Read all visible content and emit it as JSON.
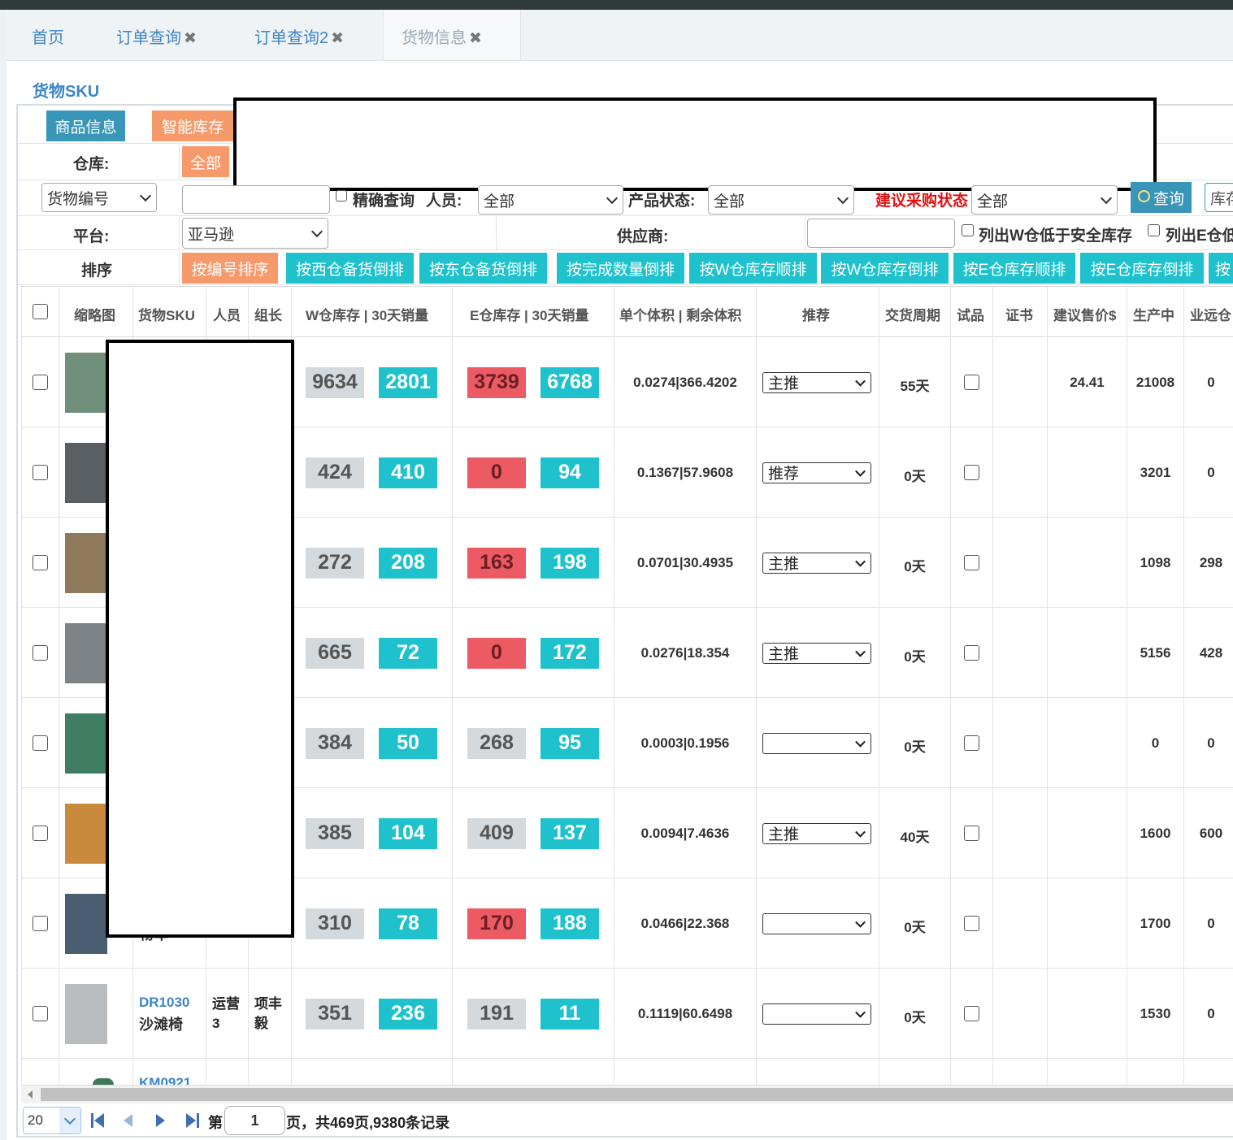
{
  "tabs": [
    {
      "label": "首页",
      "closable": false
    },
    {
      "label": "订单查询",
      "closable": true
    },
    {
      "label": "订单查询2",
      "closable": true
    },
    {
      "label": "货物信息",
      "closable": true
    }
  ],
  "close_glyph": "✖",
  "section_title": "货物SKU",
  "top_buttons": {
    "product_info": "商品信息",
    "smart_stock": "智能库存"
  },
  "warehouse": {
    "label": "仓库:",
    "all_button": "全部"
  },
  "filters": {
    "field_select": "货物编号",
    "exact_checkbox_label": "精确查询",
    "staff_label": "人员:",
    "staff_value": "全部",
    "product_status_label": "产品状态:",
    "product_status_value": "全部",
    "purchase_status_label": "建议采购状态",
    "purchase_status_value": "全部",
    "query_button": "查询",
    "stock_button": "库存",
    "platform_label": "平台:",
    "platform_value": "亚马逊",
    "supplier_label": "供应商:",
    "w_below_safety_label": "列出W仓低于安全库存",
    "e_below_label": "列出E仓低"
  },
  "sort": {
    "label": "排序",
    "buttons": [
      "按编号排序",
      "按西仓备货倒排",
      "按东仓备货倒排",
      "按完成数量倒排",
      "按W仓库存顺排",
      "按W仓库存倒排",
      "按E仓库存顺排",
      "按E仓库存倒排",
      "按"
    ]
  },
  "table": {
    "headers": [
      "缩略图",
      "货物SKU",
      "人员",
      "组长",
      "W仓库存 | 30天销量",
      "E仓库存 | 30天销量",
      "单个体积 | 剩余体积",
      "推荐",
      "交货周期",
      "试品",
      "证书",
      "建议售价$",
      "生产中",
      "业远仓"
    ],
    "rows": [
      {
        "sku": "",
        "name": "",
        "staff": "",
        "leader": "",
        "w_stock": "9634",
        "w_sales": "2801",
        "e_stock": "3739",
        "e_stock_status": "low",
        "e_sales": "6768",
        "volume": "0.0274|366.4202",
        "recommend": "主推",
        "delivery": "55天",
        "price": "24.41",
        "producing": "21008",
        "remote": "0"
      },
      {
        "sku": "",
        "name": "",
        "staff": "",
        "leader": "",
        "w_stock": "424",
        "w_sales": "410",
        "e_stock": "0",
        "e_stock_status": "low",
        "e_sales": "94",
        "volume": "0.1367|57.9608",
        "recommend": "推荐",
        "delivery": "0天",
        "price": "",
        "producing": "3201",
        "remote": "0"
      },
      {
        "sku": "",
        "name": "",
        "staff": "",
        "leader": "",
        "w_stock": "272",
        "w_sales": "208",
        "e_stock": "163",
        "e_stock_status": "low",
        "e_sales": "198",
        "volume": "0.0701|30.4935",
        "recommend": "主推",
        "delivery": "0天",
        "price": "",
        "producing": "1098",
        "remote": "298"
      },
      {
        "sku": "",
        "name": "",
        "staff": "",
        "leader": "",
        "w_stock": "665",
        "w_sales": "72",
        "e_stock": "0",
        "e_stock_status": "low",
        "e_sales": "172",
        "volume": "0.0276|18.354",
        "recommend": "主推",
        "delivery": "0天",
        "price": "",
        "producing": "5156",
        "remote": "428"
      },
      {
        "sku": "",
        "name": "",
        "staff": "",
        "leader": "",
        "w_stock": "384",
        "w_sales": "50",
        "e_stock": "268",
        "e_stock_status": "ok",
        "e_sales": "95",
        "volume": "0.0003|0.1956",
        "recommend": "",
        "delivery": "0天",
        "price": "",
        "producing": "0",
        "remote": "0"
      },
      {
        "sku": "",
        "name": "",
        "staff": "",
        "leader": "",
        "w_stock": "385",
        "w_sales": "104",
        "e_stock": "409",
        "e_stock_status": "ok",
        "e_sales": "137",
        "volume": "0.0094|7.4636",
        "recommend": "主推",
        "delivery": "40天",
        "price": "",
        "producing": "1600",
        "remote": "600"
      },
      {
        "sku": "",
        "name": "物车",
        "staff": "",
        "leader": "",
        "w_stock": "310",
        "w_sales": "78",
        "e_stock": "170",
        "e_stock_status": "low",
        "e_sales": "188",
        "volume": "0.0466|22.368",
        "recommend": "",
        "delivery": "0天",
        "price": "",
        "producing": "1700",
        "remote": "0"
      },
      {
        "sku": "DR1030",
        "name": "沙滩椅",
        "staff": "运营3",
        "leader": "项丰毅",
        "w_stock": "351",
        "w_sales": "236",
        "e_stock": "191",
        "e_stock_status": "ok",
        "e_sales": "11",
        "volume": "0.1119|60.6498",
        "recommend": "",
        "delivery": "0天",
        "price": "",
        "producing": "1530",
        "remote": "0"
      }
    ],
    "partial_row_sku": "KM0921"
  },
  "pager": {
    "page_size": "20",
    "prefix": "第",
    "page": "1",
    "suffix": "页，共469页,9380条记录"
  },
  "colors": {
    "tab_text": "#3d86c6",
    "orange": "#f79a6b",
    "teal": "#1fc2cc",
    "blue_button": "#3a96b8",
    "red_text": "#e01010"
  }
}
